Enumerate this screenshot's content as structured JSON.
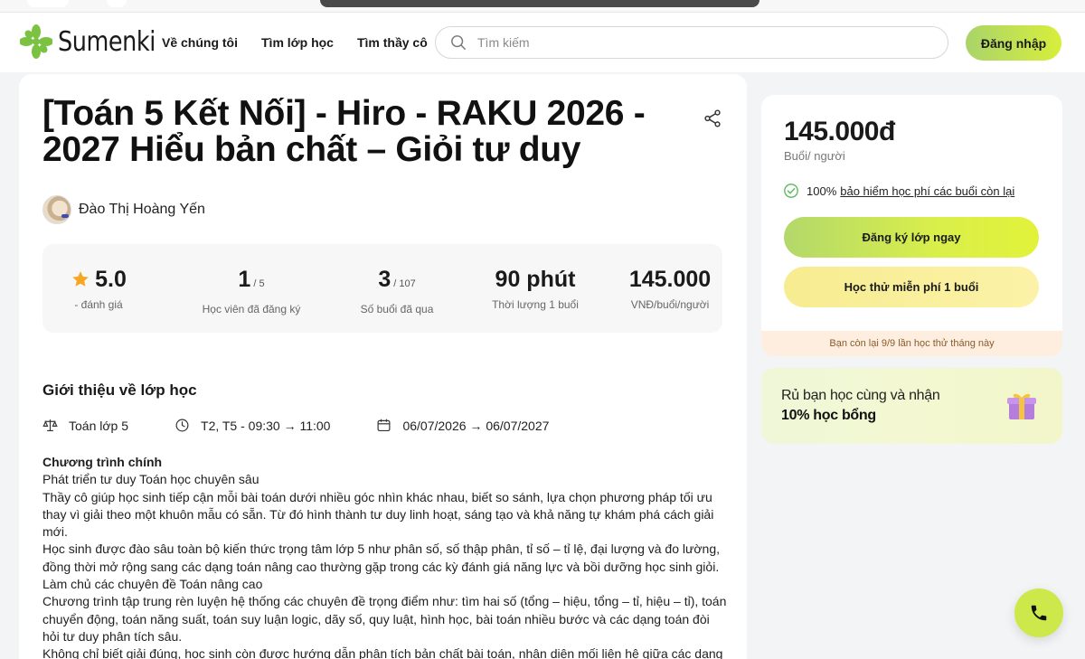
{
  "header": {
    "brand": "Sumenki",
    "nav": [
      "Về chúng tôi",
      "Tìm lớp học",
      "Tìm thầy cô"
    ],
    "search_placeholder": "Tìm kiếm",
    "login_label": "Đăng nhập"
  },
  "course": {
    "title": "[Toán 5 Kết Nối] - Hiro - RAKU 2026 - 2027 Hiểu bản chất – Giỏi tư duy",
    "teacher": "Đào Thị Hoàng Yến",
    "stats": [
      {
        "value": "5.0",
        "suffix": "",
        "caption": "- đánh giá"
      },
      {
        "value": "1",
        "suffix": "/ 5",
        "caption": "Học viên đã đăng ký"
      },
      {
        "value": "3",
        "suffix": "/ 107",
        "caption": "Số buổi đã qua"
      },
      {
        "value": "90 phút",
        "suffix": "",
        "caption": "Thời lượng 1 buổi"
      },
      {
        "value": "145.000",
        "suffix": "",
        "caption": "VNĐ/buổi/người"
      }
    ],
    "section_title": "Giới thiệu về lớp học",
    "subject": "Toán lớp 5",
    "schedule": "T2, T5 - 09:30 → 11:00",
    "date_range": "06/07/2026 → 06/07/2027",
    "description": [
      {
        "text": "Chương trình chính",
        "bold": true
      },
      {
        "text": "Phát triển tư duy Toán học chuyên sâu",
        "bold": false
      },
      {
        "text": "Thầy cô giúp học sinh tiếp cận mỗi bài toán dưới nhiều góc nhìn khác nhau, biết so sánh, lựa chọn phương pháp tối ưu thay vì giải theo một khuôn mẫu có sẵn. Từ đó hình thành tư duy linh hoạt, sáng tạo và khả năng tự khám phá cách giải mới.",
        "bold": false
      },
      {
        "text": "Học sinh được đào sâu toàn bộ kiến thức trọng tâm lớp 5 như phân số, số thập phân, tỉ số – tỉ lệ, đại lượng và đo lường, đồng thời mở rộng sang các dạng toán nâng cao thường gặp trong các kỳ đánh giá năng lực và bồi dưỡng học sinh giỏi.",
        "bold": false
      },
      {
        "text": "Làm chủ các chuyên đề Toán nâng cao",
        "bold": false
      },
      {
        "text": "Chương trình tập trung rèn luyện hệ thống các chuyên đề trọng điểm như: tìm hai số (tổng – hiệu, tổng – tỉ, hiệu – tỉ), toán chuyển động, toán năng suất, toán suy luận logic, dãy số, quy luật, hình học, bài toán nhiều bước và các dạng toán đòi hỏi tư duy phân tích sâu.",
        "bold": false
      },
      {
        "text": "Không chỉ biết giải đúng, học sinh còn được hướng dẫn phân tích bản chất bài toán, nhận diện mối liên hệ giữa các dạng toán để vận dụng linh hoạt vào những bài toán mới.",
        "bold": false
      }
    ]
  },
  "pricing": {
    "price": "145.000đ",
    "unit": "Buổi/ người",
    "insurance_prefix": "100%",
    "insurance_link": "bảo hiểm học phí các buổi còn lại",
    "register_label": "Đăng ký lớp ngay",
    "trial_label": "Học thử miễn phí 1 buổi",
    "trial_note": "Bạn còn lại 9/9 lần học thử tháng này"
  },
  "promo": {
    "line1": "Rủ bạn học cùng và nhận",
    "line2": "10% học bổng"
  },
  "colors": {
    "accent_green": "#cde84a",
    "page_bg": "#f3f4f6",
    "star": "#f5a623",
    "brand_green": "#7cc242"
  }
}
